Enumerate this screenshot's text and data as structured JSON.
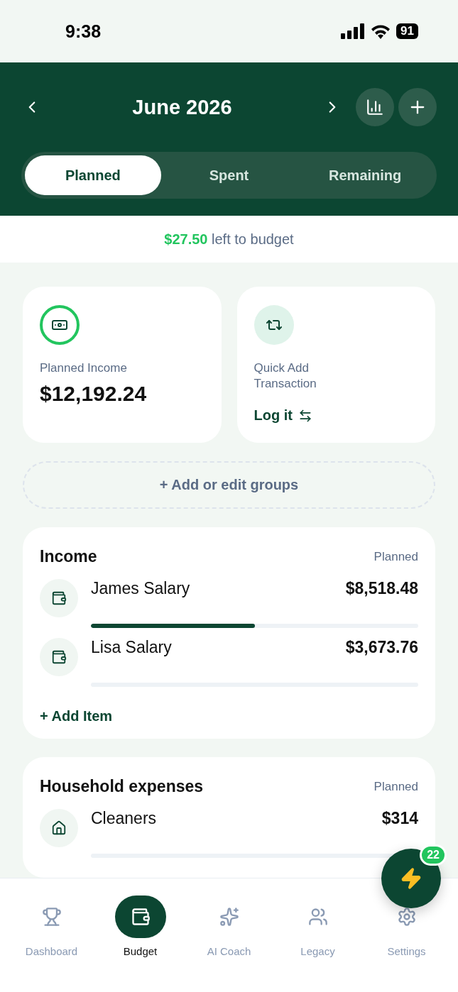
{
  "status_bar": {
    "time": "9:38",
    "battery": "91"
  },
  "header": {
    "month": "June 2026"
  },
  "tabs": [
    {
      "label": "Planned",
      "selected": true
    },
    {
      "label": "Spent",
      "selected": false
    },
    {
      "label": "Remaining",
      "selected": false
    }
  ],
  "summary": {
    "amount": "$27.50",
    "text": "left to budget"
  },
  "cards": [
    {
      "kind": "income",
      "label": "Planned Income",
      "value": "$12,192.24"
    },
    {
      "kind": "quick_add",
      "label": "Quick Add Transaction",
      "link": "Log it"
    }
  ],
  "add_groups": "+ Add or edit groups",
  "groups": [
    {
      "title": "Income",
      "column": "Planned",
      "add_item": "+ Add Item",
      "items": [
        {
          "name": "James Salary",
          "amount": "$8,518.48",
          "level": 0.5
        },
        {
          "name": "Lisa Salary",
          "amount": "$3,673.76"
        }
      ]
    },
    {
      "title": "Household expenses",
      "column": "Planned",
      "items": [
        {
          "name": "Cleaners",
          "amount": "$314"
        }
      ]
    }
  ],
  "fab": {
    "badge": "22"
  },
  "nav": [
    {
      "label": "Dashboard",
      "selected": false
    },
    {
      "label": "Budget",
      "selected": true
    },
    {
      "label": "AI Coach",
      "selected": false
    },
    {
      "label": "Legacy",
      "selected": false
    },
    {
      "label": "Settings",
      "selected": false
    }
  ]
}
